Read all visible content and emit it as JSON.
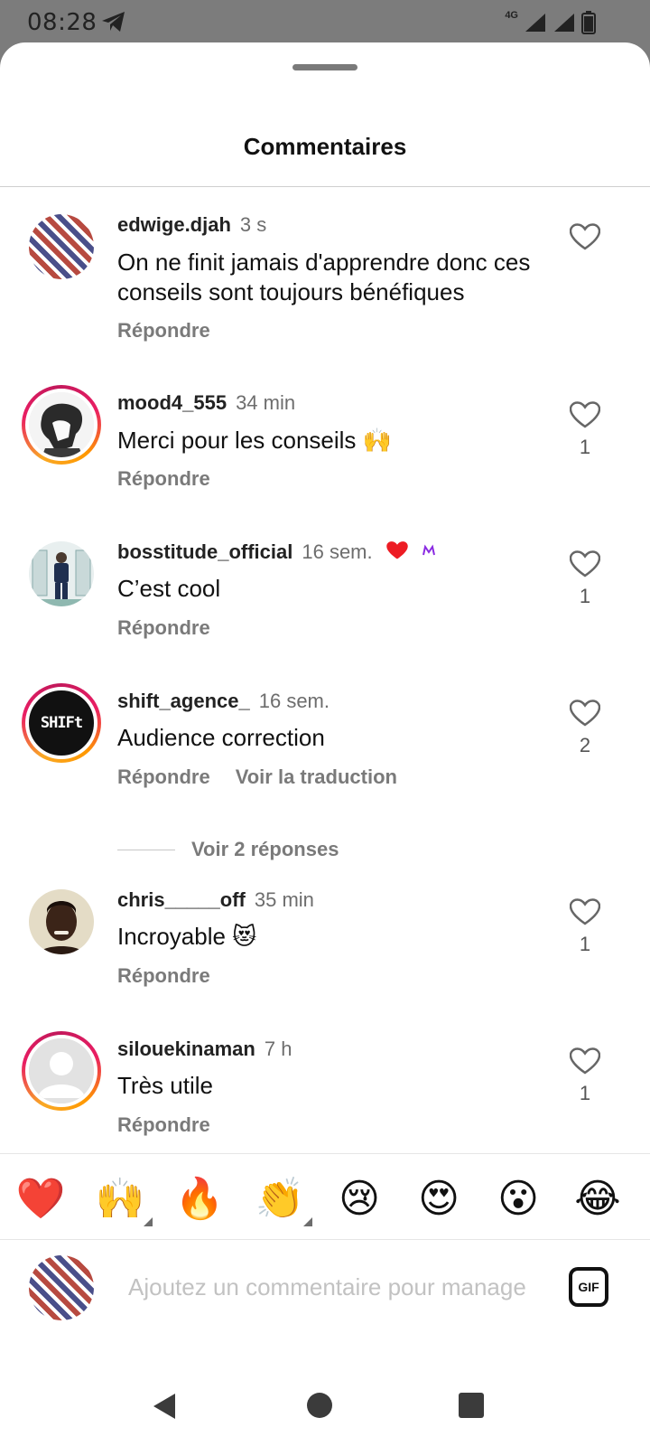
{
  "status_bar": {
    "time": "08:28",
    "network": "4G"
  },
  "header": {
    "title": "Commentaires"
  },
  "comments": [
    {
      "user": "edwige.djah",
      "time": "3 s",
      "text": "On ne finit jamais d'apprendre donc ces conseils sont toujours bénéfiques",
      "reply": "Répondre",
      "likes": ""
    },
    {
      "user": "mood4_555",
      "time": "34 min",
      "text": "Merci pour les conseils 🙌",
      "reply": "Répondre",
      "likes": "1"
    },
    {
      "user": "bosstitude_official",
      "time": "16 sem.",
      "text": "C’est cool",
      "reply": "Répondre",
      "likes": "1"
    },
    {
      "user": "shift_agence_",
      "time": "16 sem.",
      "text": "Audience correction",
      "reply": "Répondre",
      "translate": "Voir la traduction",
      "likes": "2",
      "view_replies": "Voir 2 réponses",
      "avatar_text": "SHIFt"
    },
    {
      "user": "chris_____off",
      "time": "35 min",
      "text": "Incroyable 😻",
      "reply": "Répondre",
      "likes": "1"
    },
    {
      "user": "silouekinaman",
      "time": "7 h",
      "text": "Très utile",
      "reply": "Répondre",
      "likes": "1"
    }
  ],
  "emoji_bar": [
    "❤️",
    "🙌",
    "🔥",
    "👏",
    "😢",
    "😍",
    "😮",
    "😂"
  ],
  "composer": {
    "placeholder": "Ajoutez un commentaire pour manage",
    "gif_label": "GIF"
  },
  "colors": {
    "liked_heart": "#ed1c24",
    "meta_gray": "#7a7a7a"
  }
}
